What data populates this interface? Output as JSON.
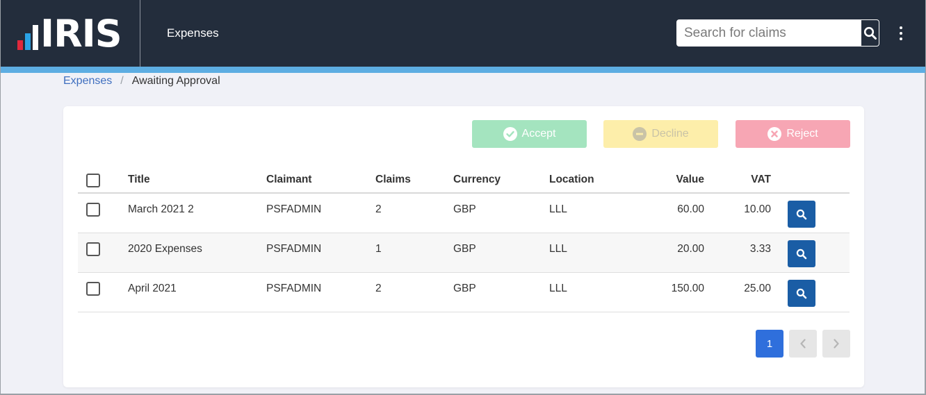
{
  "header": {
    "logo_text": "IRIS",
    "app_title": "Expenses",
    "search": {
      "placeholder": "Search for claims",
      "value": ""
    }
  },
  "breadcrumb": {
    "root": "Expenses",
    "separator": "/",
    "current": "Awaiting Approval"
  },
  "actions": {
    "accept": "Accept",
    "decline": "Decline",
    "reject": "Reject"
  },
  "table": {
    "columns": {
      "title": "Title",
      "claimant": "Claimant",
      "claims": "Claims",
      "currency": "Currency",
      "location": "Location",
      "value": "Value",
      "vat": "VAT"
    },
    "rows": [
      {
        "title": "March 2021 2",
        "claimant": "PSFADMIN",
        "claims": "2",
        "currency": "GBP",
        "location": "LLL",
        "value": "60.00",
        "vat": "10.00"
      },
      {
        "title": "2020 Expenses",
        "claimant": "PSFADMIN",
        "claims": "1",
        "currency": "GBP",
        "location": "LLL",
        "value": "20.00",
        "vat": "3.33"
      },
      {
        "title": "April 2021",
        "claimant": "PSFADMIN",
        "claims": "2",
        "currency": "GBP",
        "location": "LLL",
        "value": "150.00",
        "vat": "25.00"
      }
    ]
  },
  "pagination": {
    "current_page": "1"
  },
  "colors": {
    "topbar": "#232d3c",
    "accent_strip": "#5dade2",
    "accept": "#a4e4bf",
    "decline": "#fdeeaa",
    "reject": "#f7a6b4",
    "view_button": "#1a5da5",
    "page_active": "#2f6fdc"
  },
  "icons": {
    "search": "search-icon",
    "menu": "kebab-menu-icon",
    "accept": "check-circle-icon",
    "decline": "minus-circle-icon",
    "reject": "x-circle-icon",
    "view": "search-icon",
    "prev": "chevron-left-icon",
    "next": "chevron-right-icon"
  }
}
